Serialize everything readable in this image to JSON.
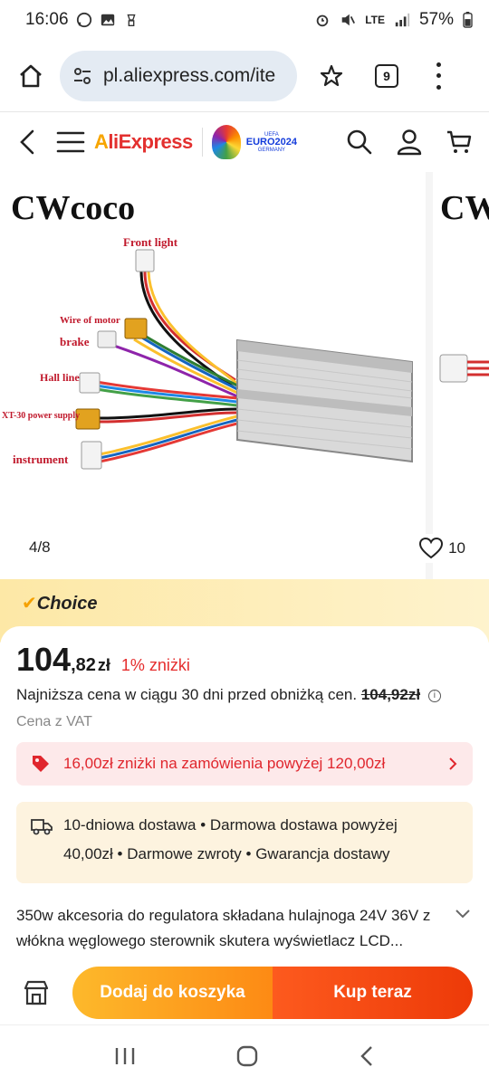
{
  "status_bar": {
    "time": "16:06",
    "network": "LTE",
    "battery": "57%"
  },
  "browser": {
    "url": "pl.aliexpress.com/ite",
    "tab_count": "9"
  },
  "header": {
    "logo_a": "A",
    "logo_rest": "liExpress",
    "euro_top": "UEFA",
    "euro_main": "EURO2024",
    "euro_sub": "GERMANY"
  },
  "gallery": {
    "brand": "CWcoco",
    "brand_next": "CW",
    "labels": {
      "front_light": "Front light",
      "wire_of_motor": "Wire of motor",
      "brake": "brake",
      "hall_line": "Hall line",
      "xt30": "XT-30 power supply",
      "instrument": "instrument"
    },
    "counter": "4/8",
    "wishlist_count": "10"
  },
  "choice": {
    "label": "Choice"
  },
  "price": {
    "integer": "104",
    "decimal": ",82",
    "currency": "zł",
    "discount": "1% zniżki",
    "lowest_prefix": "Najniższa cena w ciągu 30 dni przed obniżką cen.",
    "lowest_value": "104,92zł",
    "vat": "Cena z VAT"
  },
  "coupon": {
    "text": "16,00zł zniżki na zamówienia powyżej 120,00zł"
  },
  "delivery": {
    "line1": "10-dniowa dostawa • Darmowa dostawa powyżej",
    "line2": "40,00zł • Darmowe zwroty • Gwarancja dostawy"
  },
  "product": {
    "title": "350w akcesoria do regulatora składana hulajnoga 24V 36V z włókna węglowego sterownik skutera wyświetlacz LCD..."
  },
  "actions": {
    "add_to_cart": "Dodaj do koszyka",
    "buy_now": "Kup teraz"
  },
  "colors": {
    "brand_red": "#e3302f",
    "brand_orange": "#f7a500",
    "discount_red": "#e52d2d",
    "cart_orange": "#fd9e20",
    "buy_red": "#f44a12"
  }
}
